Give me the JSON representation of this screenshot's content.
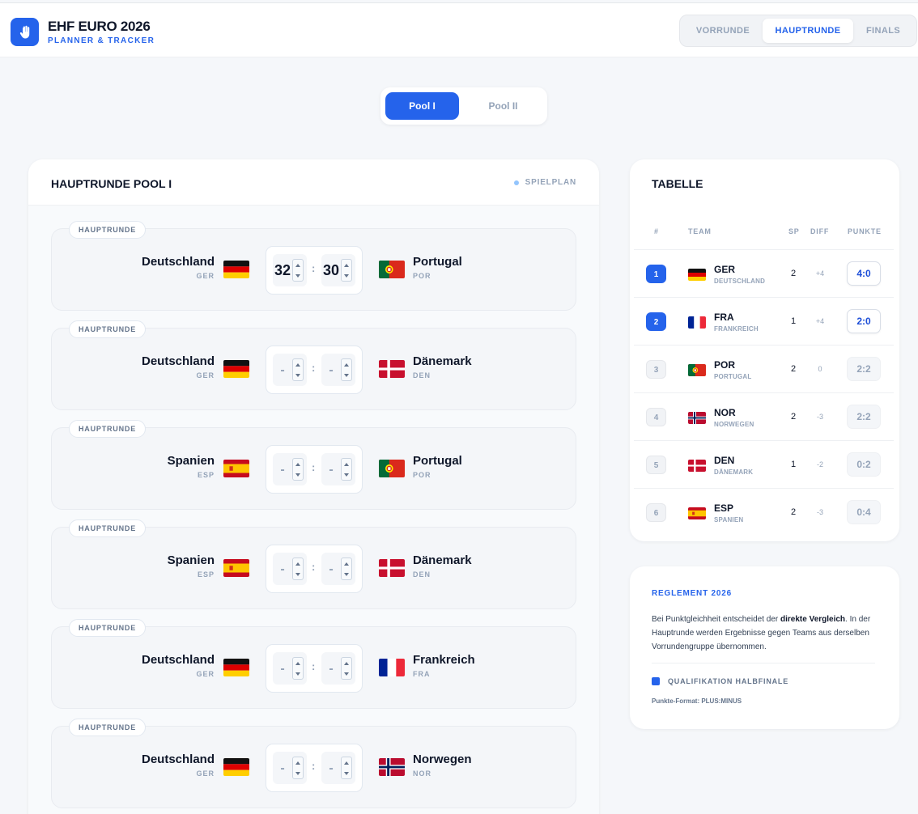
{
  "app": {
    "title": "EHF EURO 2026",
    "subtitle": "PLANNER & TRACKER"
  },
  "nav": {
    "tabs": [
      {
        "label": "VORRUNDE"
      },
      {
        "label": "HAUPTRUNDE",
        "active": true
      },
      {
        "label": "FINALS"
      }
    ]
  },
  "pools": [
    {
      "label": "Pool I",
      "active": true
    },
    {
      "label": "Pool II"
    }
  ],
  "matches": {
    "title": "HAUPTRUNDE POOL I",
    "schedule_label": "SPIELPLAN",
    "list": [
      {
        "badge": "HAUPTRUNDE",
        "home": {
          "name": "Deutschland",
          "code": "GER",
          "flag": "ger"
        },
        "home_score": "32",
        "away_score": "30",
        "away": {
          "name": "Portugal",
          "code": "POR",
          "flag": "por"
        }
      },
      {
        "badge": "HAUPTRUNDE",
        "home": {
          "name": "Deutschland",
          "code": "GER",
          "flag": "ger"
        },
        "home_score": "-",
        "away_score": "-",
        "away": {
          "name": "Dänemark",
          "code": "DEN",
          "flag": "den"
        }
      },
      {
        "badge": "HAUPTRUNDE",
        "home": {
          "name": "Spanien",
          "code": "ESP",
          "flag": "esp"
        },
        "home_score": "-",
        "away_score": "-",
        "away": {
          "name": "Portugal",
          "code": "POR",
          "flag": "por"
        }
      },
      {
        "badge": "HAUPTRUNDE",
        "home": {
          "name": "Spanien",
          "code": "ESP",
          "flag": "esp"
        },
        "home_score": "-",
        "away_score": "-",
        "away": {
          "name": "Dänemark",
          "code": "DEN",
          "flag": "den"
        }
      },
      {
        "badge": "HAUPTRUNDE",
        "home": {
          "name": "Deutschland",
          "code": "GER",
          "flag": "ger"
        },
        "home_score": "-",
        "away_score": "-",
        "away": {
          "name": "Frankreich",
          "code": "FRA",
          "flag": "fra"
        }
      },
      {
        "badge": "HAUPTRUNDE",
        "home": {
          "name": "Deutschland",
          "code": "GER",
          "flag": "ger"
        },
        "home_score": "-",
        "away_score": "-",
        "away": {
          "name": "Norwegen",
          "code": "NOR",
          "flag": "nor"
        }
      }
    ]
  },
  "standings": {
    "title": "TABELLE",
    "columns": {
      "rank": "#",
      "team": "TEAM",
      "played": "SP",
      "diff": "DIFF",
      "points": "PUNKTE"
    },
    "rows": [
      {
        "rank": "1",
        "code": "GER",
        "name": "DEUTSCHLAND",
        "flag": "ger",
        "played": "2",
        "diff": "+4",
        "points": "4:0",
        "qualified": true
      },
      {
        "rank": "2",
        "code": "FRA",
        "name": "FRANKREICH",
        "flag": "fra",
        "played": "1",
        "diff": "+4",
        "points": "2:0",
        "qualified": true
      },
      {
        "rank": "3",
        "code": "POR",
        "name": "PORTUGAL",
        "flag": "por",
        "played": "2",
        "diff": "0",
        "points": "2:2",
        "qualified": false
      },
      {
        "rank": "4",
        "code": "NOR",
        "name": "NORWEGEN",
        "flag": "nor",
        "played": "2",
        "diff": "-3",
        "points": "2:2",
        "qualified": false
      },
      {
        "rank": "5",
        "code": "DEN",
        "name": "DÄNEMARK",
        "flag": "den",
        "played": "1",
        "diff": "-2",
        "points": "0:2",
        "qualified": false
      },
      {
        "rank": "6",
        "code": "ESP",
        "name": "SPANIEN",
        "flag": "esp",
        "played": "2",
        "diff": "-3",
        "points": "0:4",
        "qualified": false
      }
    ]
  },
  "rules": {
    "title": "REGLEMENT 2026",
    "text_before": "Bei Punktgleichheit entscheidet der ",
    "text_bold": "direkte Vergleich",
    "text_after": ". In der Hauptrunde werden Ergebnisse gegen Teams aus derselben Vorrundengruppe übernommen.",
    "legend": "QUALIFIKATION HALBFINALE",
    "format": "Punkte-Format: PLUS:MINUS"
  },
  "colors": {
    "accent": "#2563eb",
    "background": "#f5f7fa",
    "muted": "#94a3b8"
  }
}
